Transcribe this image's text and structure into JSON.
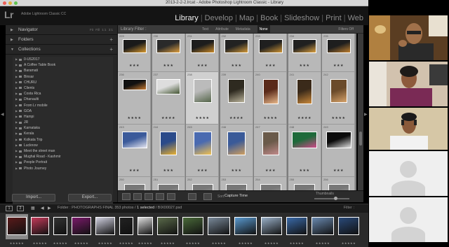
{
  "window": {
    "title": "2013-2-2-2.lrcat - Adobe Photoshop Lightroom Classic - Library"
  },
  "app": {
    "logo": "Lr",
    "name": "Adobe Lightroom Classic CC"
  },
  "modules": {
    "library": "Library",
    "develop": "Develop",
    "map": "Map",
    "book": "Book",
    "slideshow": "Slideshow",
    "print": "Print",
    "web": "Web",
    "separator": "|"
  },
  "left_panel": {
    "navigator": {
      "label": "Navigator",
      "zoom_options": "Fit  Fill  1:1  3:1"
    },
    "folders": {
      "label": "Folders"
    },
    "collections": {
      "label": "Collections",
      "items": [
        "0-US2017",
        "A Coffee Table Book",
        "Baramati",
        "Binsar",
        "CHURU",
        "Clients",
        "Costa Rica",
        "Dhanaulti",
        "From Lr mobile",
        "GOA",
        "Hampi",
        "JR",
        "Karnataka",
        "Kerala",
        "Kolkata Trip",
        "Lucknow",
        "Meet the street man",
        "Mughal Road - Kashmir",
        "People Portrait",
        "Photo Journey"
      ]
    },
    "import_label": "Import...",
    "export_label": "Export..."
  },
  "filter_bar": {
    "title": "Library Filter :",
    "options": [
      "Text",
      "Attribute",
      "Metadata",
      "None"
    ],
    "active": "None",
    "filters_off": "Filters Off"
  },
  "grid": {
    "rows": [
      {
        "nums": [
          "229",
          "230",
          "231",
          "232",
          "233",
          "234",
          "235"
        ],
        "stars": "★★★"
      },
      {
        "nums": [
          "236",
          "237",
          "238",
          "239",
          "240",
          "241",
          "242"
        ],
        "stars": "★★★★"
      },
      {
        "nums": [
          "243",
          "244",
          "245",
          "246",
          "247",
          "248",
          "249"
        ],
        "stars": "★★★"
      },
      {
        "nums": [
          "250",
          "251",
          "252",
          "253",
          "254",
          "255",
          "256"
        ],
        "stars": "★★★"
      }
    ]
  },
  "toolbar": {
    "sort_label": "Sort:",
    "sort_value": "Capture Time",
    "thumbnails_label": "Thumbnails"
  },
  "filmstrip_header": {
    "monitor1": "1",
    "monitor2": "2",
    "folder_prefix": "Folder : PHOTOGRAPHS FINAL",
    "count": "353 photos /",
    "selected": "1 selected",
    "filename": "/ BIX00027.psd",
    "filter_label": "Filter :"
  },
  "filmstrip": {
    "stars": "★★★★★"
  },
  "colors": {
    "panel_bg": "#262626",
    "grid_bg": "#7d7d7d",
    "cell_bg": "#b8b8b8",
    "active_module": "#f0f0f0",
    "video_bg": "#000000",
    "avatar_tile": "#efefef",
    "avatar_fg": "#d3d3d3"
  }
}
